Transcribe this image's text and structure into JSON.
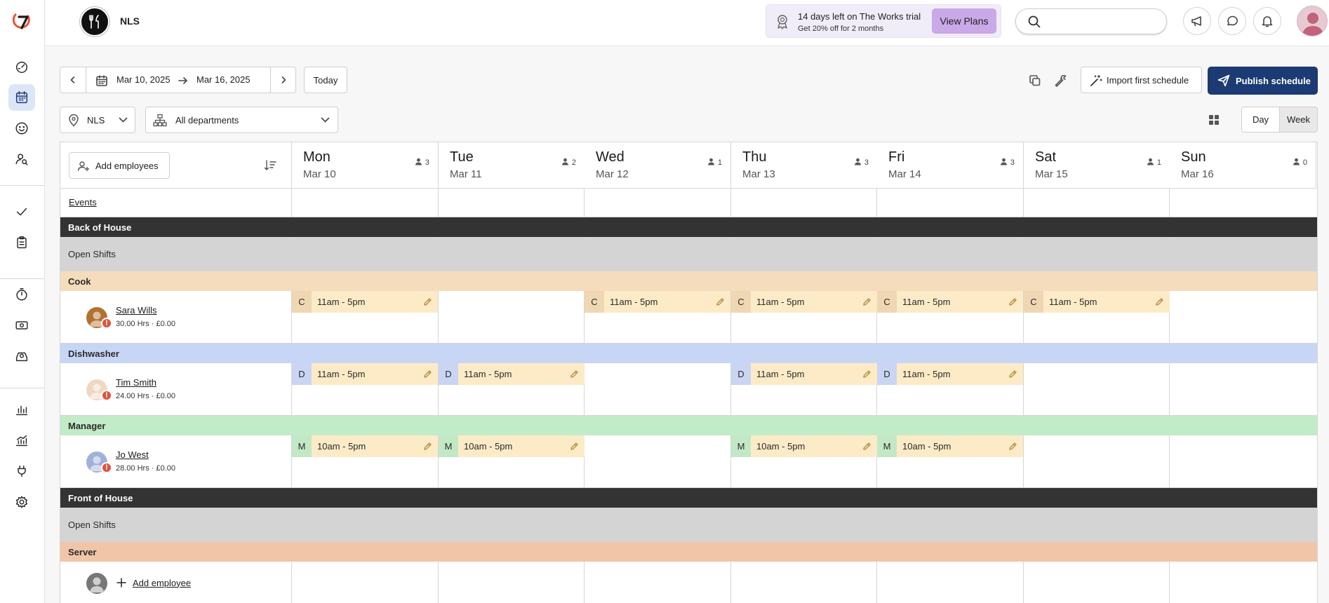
{
  "brand": {
    "name": "NLS"
  },
  "trial": {
    "title": "14 days left on The Works trial",
    "subtitle": "Get 20% off for 2 months",
    "button": "View Plans"
  },
  "search": {
    "placeholder": ""
  },
  "toolbar": {
    "start_date": "Mar 10, 2025",
    "end_date": "Mar 16, 2025",
    "today": "Today",
    "import": "Import first schedule",
    "publish": "Publish schedule"
  },
  "filters": {
    "location": "NLS",
    "department": "All departments",
    "view_day": "Day",
    "view_week": "Week"
  },
  "grid": {
    "add_employees": "Add employees",
    "events": "Events",
    "days": [
      {
        "name": "Mon",
        "date": "Mar 10",
        "count": "3"
      },
      {
        "name": "Tue",
        "date": "Mar 11",
        "count": "2"
      },
      {
        "name": "Wed",
        "date": "Mar 12",
        "count": "1"
      },
      {
        "name": "Thu",
        "date": "Mar 13",
        "count": "3"
      },
      {
        "name": "Fri",
        "date": "Mar 14",
        "count": "3"
      },
      {
        "name": "Sat",
        "date": "Mar 15",
        "count": "1"
      },
      {
        "name": "Sun",
        "date": "Mar 16",
        "count": "0"
      }
    ],
    "departments": [
      {
        "name": "Back of House",
        "open_shifts": "Open Shifts"
      },
      {
        "name": "Front of House",
        "open_shifts": "Open Shifts"
      }
    ],
    "roles": [
      {
        "name": "Cook",
        "color": "#f4dcbd",
        "code_color": "#f0d7b4",
        "employee": {
          "name": "Sara Wills",
          "meta": "30.00 Hrs · £0.00",
          "avatar_color": "#b3712f"
        },
        "shifts": [
          {
            "code": "C",
            "time": "11am - 5pm"
          },
          null,
          {
            "code": "C",
            "time": "11am - 5pm"
          },
          {
            "code": "C",
            "time": "11am - 5pm"
          },
          {
            "code": "C",
            "time": "11am - 5pm"
          },
          {
            "code": "C",
            "time": "11am - 5pm"
          },
          null
        ]
      },
      {
        "name": "Dishwasher",
        "color": "#c8d6f6",
        "code_color": "#c9d5f3",
        "employee": {
          "name": "Tim Smith",
          "meta": "24.00 Hrs · £0.00",
          "avatar_color": "#efd8c3"
        },
        "shifts": [
          {
            "code": "D",
            "time": "11am - 5pm"
          },
          {
            "code": "D",
            "time": "11am - 5pm"
          },
          null,
          {
            "code": "D",
            "time": "11am - 5pm"
          },
          {
            "code": "D",
            "time": "11am - 5pm"
          },
          null,
          null
        ]
      },
      {
        "name": "Manager",
        "color": "#c2ebc8",
        "code_color": "#c3e8c6",
        "employee": {
          "name": "Jo West",
          "meta": "28.00 Hrs · £0.00",
          "avatar_color": "#9eb2d9"
        },
        "shifts": [
          {
            "code": "M",
            "time": "10am - 5pm"
          },
          {
            "code": "M",
            "time": "10am - 5pm"
          },
          null,
          {
            "code": "M",
            "time": "10am - 5pm"
          },
          {
            "code": "M",
            "time": "10am - 5pm"
          },
          null,
          null
        ]
      }
    ],
    "server_role": {
      "name": "Server",
      "color": "#f0c5a8",
      "add_employee": "Add employee"
    }
  }
}
